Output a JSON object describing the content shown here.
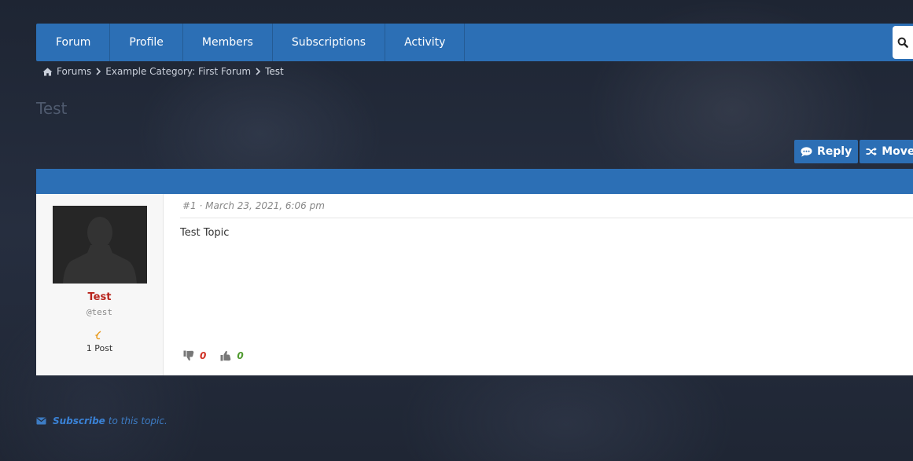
{
  "nav": {
    "items": [
      {
        "label": "Forum"
      },
      {
        "label": "Profile"
      },
      {
        "label": "Members"
      },
      {
        "label": "Subscriptions"
      },
      {
        "label": "Activity"
      }
    ],
    "search_icon": "search-icon"
  },
  "breadcrumb": {
    "home_icon": "home-icon",
    "items": [
      "Forums",
      "Example Category: First Forum",
      "Test"
    ]
  },
  "page": {
    "title": "Test"
  },
  "actions": {
    "reply_label": "Reply",
    "move_label": "Move"
  },
  "post": {
    "meta": "#1 · March 23, 2021, 6:06 pm",
    "text": "Test Topic",
    "author": {
      "name": "Test",
      "handle": "@test",
      "posts": "1 Post"
    },
    "votes": {
      "down": "0",
      "up": "0"
    }
  },
  "subscribe": {
    "link": "Subscribe",
    "text": "to this topic."
  },
  "colors": {
    "accent": "#2c6fb5",
    "author_name": "#b8241c",
    "vote_down": "#d03024",
    "vote_up": "#4f9a2f"
  }
}
